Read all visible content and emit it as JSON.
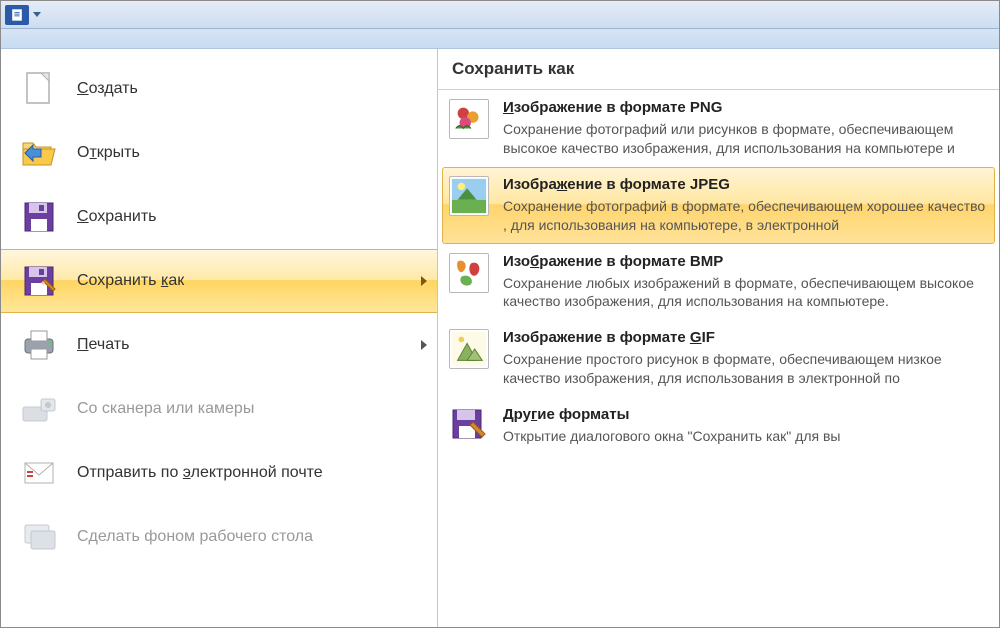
{
  "titlebar": {
    "dropdown": "▼"
  },
  "left_menu": {
    "items": [
      {
        "id": "new",
        "pre": "",
        "accel": "С",
        "post": "оздать",
        "has_arrow": false,
        "disabled": false
      },
      {
        "id": "open",
        "pre": "О",
        "accel": "т",
        "post": "крыть",
        "has_arrow": false,
        "disabled": false
      },
      {
        "id": "save",
        "pre": "",
        "accel": "С",
        "post": "охранить",
        "has_arrow": false,
        "disabled": false
      },
      {
        "id": "saveas",
        "pre": "Сохранить ",
        "accel": "к",
        "post": "ак",
        "has_arrow": true,
        "disabled": false,
        "selected": true
      },
      {
        "id": "print",
        "pre": "",
        "accel": "П",
        "post": "ечать",
        "has_arrow": true,
        "disabled": false
      },
      {
        "id": "scanner",
        "pre": "Со сканера или камеры",
        "accel": "",
        "post": "",
        "has_arrow": false,
        "disabled": true
      },
      {
        "id": "email",
        "pre": "Отправить по ",
        "accel": "э",
        "post": "лектронной почте",
        "has_arrow": false,
        "disabled": false
      },
      {
        "id": "desktop",
        "pre": "Сделать фоном рабочего стола",
        "accel": "",
        "post": "",
        "has_arrow": true,
        "disabled": true
      }
    ]
  },
  "right_panel": {
    "header": "Сохранить как",
    "options": [
      {
        "id": "png",
        "title_pre": "",
        "title_accel": "И",
        "title_post": "зображение в формате PNG",
        "desc": "Сохранение фотографий или рисунков в формате, обеспечивающем высокое качество изображения, для использования на компьютере и"
      },
      {
        "id": "jpeg",
        "title_pre": "Изобра",
        "title_accel": "ж",
        "title_post": "ение в формате JPEG",
        "highlight": true,
        "desc": "Сохранение фотографий в формате, обеспечивающем хорошее качество , для использования на компьютере, в электронной"
      },
      {
        "id": "bmp",
        "title_pre": "Изо",
        "title_accel": "б",
        "title_post": "ражение в формате BMP",
        "desc": "Сохранение любых изображений в формате, обеспечивающем высокое качество изображения, для использования на компьютере."
      },
      {
        "id": "gif",
        "title_pre": "Изображение в формате ",
        "title_accel": "G",
        "title_post": "IF",
        "desc": "Сохранение простого рисунок в формате, обеспечивающем низкое качество изображения, для использования в электронной по"
      },
      {
        "id": "other",
        "title_pre": "Дру",
        "title_accel": "г",
        "title_post": "ие форматы",
        "desc": "Открытие диалогового окна \"Сохранить как\" для вы"
      }
    ]
  }
}
